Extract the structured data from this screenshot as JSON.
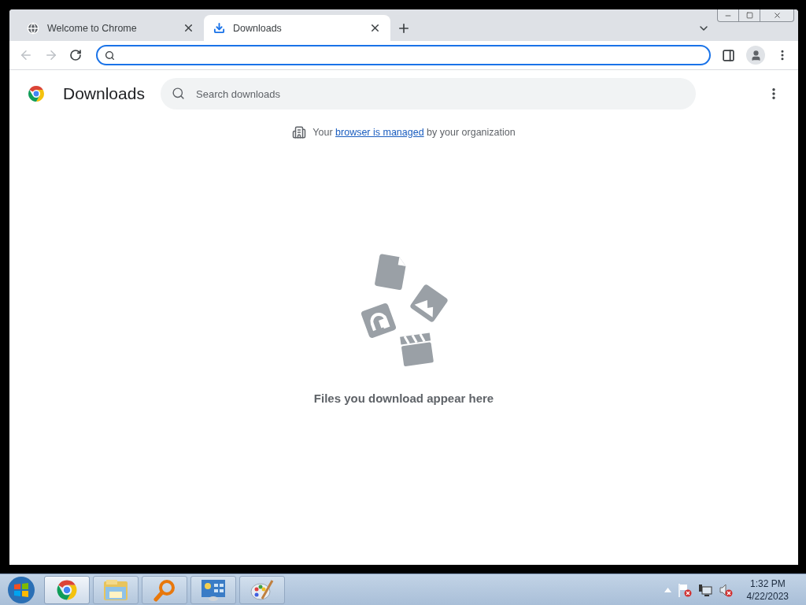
{
  "tabs": [
    {
      "title": "Welcome to Chrome",
      "kind": "globe",
      "selected": false
    },
    {
      "title": "Downloads",
      "kind": "download",
      "selected": true
    }
  ],
  "address_bar": {
    "focused": true
  },
  "page": {
    "title": "Downloads",
    "search_placeholder": "Search downloads",
    "notice_before": "Your",
    "notice_link": "browser is managed",
    "notice_after": "by your organization",
    "empty_message": "Files you download appear here"
  },
  "taskbar": {
    "apps": [
      {
        "kind": "chrome",
        "selected": true
      },
      {
        "kind": "explorer",
        "selected": false
      },
      {
        "kind": "magnifier",
        "selected": false
      },
      {
        "kind": "control-panel",
        "selected": false
      },
      {
        "kind": "paint",
        "selected": false
      }
    ],
    "time": "1:32 PM",
    "date": "4/22/2023"
  }
}
